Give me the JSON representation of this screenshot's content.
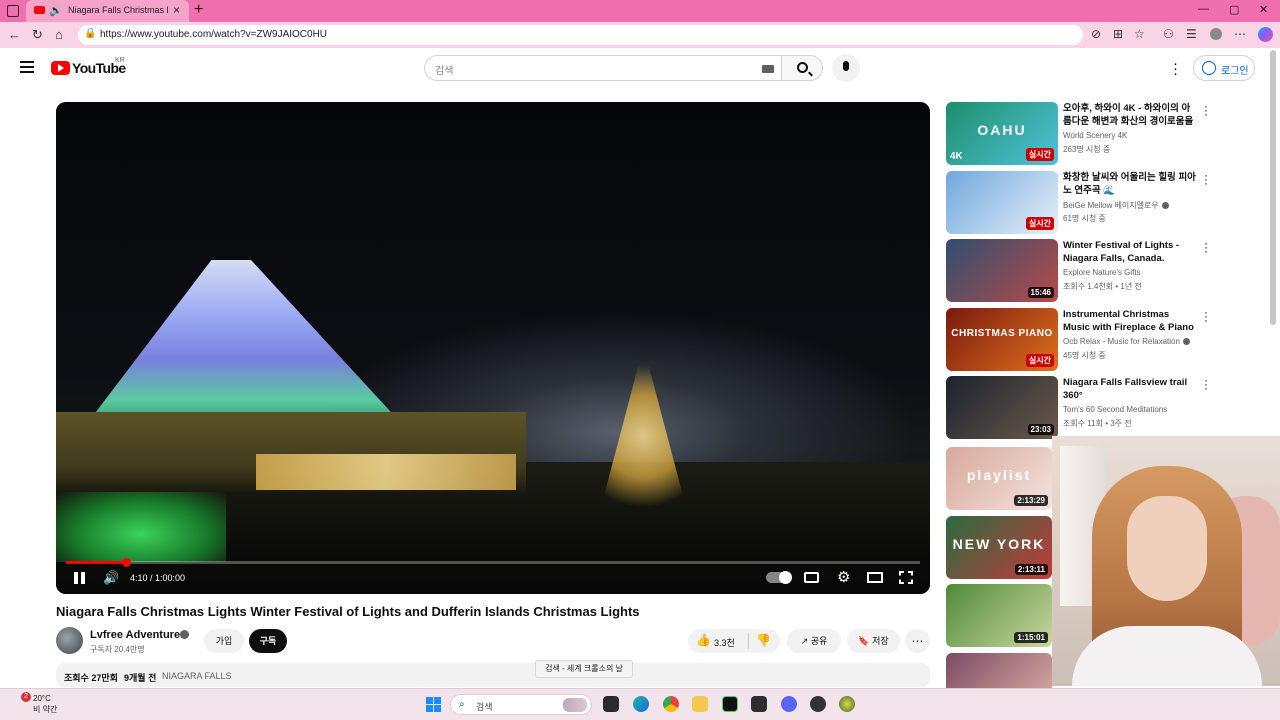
{
  "browser": {
    "tab_title": "Niagara Falls Christmas Lights",
    "url": "https://www.youtube.com/watch?v=ZW9JAIOC0HU",
    "new_tab": "+",
    "close": "×",
    "win_min": "—",
    "win_max": "▢",
    "win_close": "✕"
  },
  "youtube": {
    "logo_text": "YouTube",
    "region": "KR",
    "search_placeholder": "검색",
    "login_label": "로그인"
  },
  "player": {
    "time": "4:10 / 1:00:00",
    "progress": 0.07
  },
  "video": {
    "title": "Niagara Falls Christmas Lights Winter Festival of Lights and Dufferin Islands Christmas Lights",
    "channel": "Lvfree Adventures",
    "subscribers": "구독자 20.4만명",
    "join_label": "가입",
    "subscribe_label": "구독",
    "likes": "3.3천",
    "share_label": "공유",
    "save_label": "저장",
    "views": "조회수 27만회",
    "age": "9개월 전",
    "hashtag": "NIAGARA FALLS",
    "tooltip": "검색 - 세계 크롤소의 날"
  },
  "recommendations": [
    {
      "title": "오아후, 하와이 4K - 하와이의 아름다운 해변과 화산의 경이로움을 ...",
      "channel": "World Scenery 4K",
      "meta": "263명 시청 중",
      "badge": "실시간",
      "overlay": "OAHU",
      "corner": "4K",
      "verified": false,
      "colors": [
        "#1e8e6b",
        "#4fc3d9"
      ]
    },
    {
      "title": "화창한 날씨와 어울리는 힐링 피아노 연주곡 🌊",
      "channel": "BeiGe Mellow 베이지멜로우",
      "meta": "61명 시청 중",
      "badge": "실시간",
      "overlay": "",
      "corner": "",
      "verified": true,
      "colors": [
        "#6fa8dc",
        "#e6f0fb"
      ]
    },
    {
      "title": "Winter Festival of Lights - Niagara Falls, Canada.",
      "channel": "Explore Nature's Gifts",
      "meta": "조회수 1.4천회 • 1년 전",
      "badge": "15:46",
      "overlay": "",
      "corner": "",
      "verified": false,
      "colors": [
        "#2f4f6f",
        "#b84a4a"
      ]
    },
    {
      "title": "Instrumental Christmas Music with Fireplace & Piano Music ...",
      "channel": "Ocb Relax - Music for Relaxation",
      "meta": "45명 시청 중",
      "badge": "실시간",
      "overlay": "CHRISTMAS PIANO",
      "corner": "",
      "verified": true,
      "colors": [
        "#7a1a0f",
        "#e0701e"
      ]
    },
    {
      "title": "Niagara Falls Fallsview trail 360°",
      "channel": "Tom's 60 Second Meditations",
      "meta": "조회수 11회 • 3주 전",
      "badge": "23:03",
      "overlay": "",
      "corner": "",
      "verified": false,
      "colors": [
        "#1b2230",
        "#6b5a4a"
      ]
    },
    {
      "title": "",
      "channel": "",
      "meta": "",
      "badge": "2:13:29",
      "overlay": "playlist",
      "corner": "",
      "verified": false,
      "colors": [
        "#d8a89a",
        "#f3e3de"
      ]
    },
    {
      "title": "",
      "channel": "",
      "meta": "",
      "badge": "2:13:11",
      "overlay": "NEW YORK",
      "corner": "",
      "verified": false,
      "colors": [
        "#2b6b3f",
        "#c23b3b"
      ]
    },
    {
      "title": "",
      "channel": "",
      "meta": "",
      "badge": "1:15:01",
      "overlay": "",
      "corner": "",
      "verified": false,
      "colors": [
        "#4f8a3a",
        "#c9d6a0"
      ]
    },
    {
      "title": "",
      "channel": "",
      "meta": "",
      "badge": "",
      "overlay": "",
      "corner": "",
      "verified": false,
      "colors": [
        "#7b4b63",
        "#e2b2a8"
      ]
    }
  ],
  "taskbar": {
    "weather_temp": "20°C",
    "weather_desc": "비 약간",
    "weather_badge": "2",
    "search_placeholder": "검색"
  }
}
